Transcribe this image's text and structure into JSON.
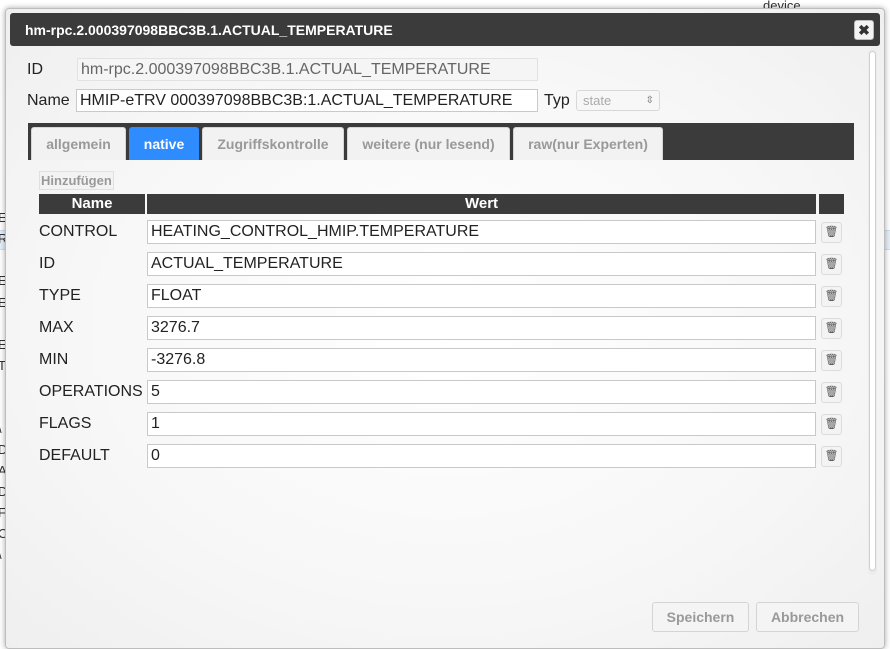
{
  "background": {
    "device_label": "device",
    "letters": [
      "E",
      "R",
      "EF",
      "E",
      "E",
      "T",
      "\\",
      "D",
      "A",
      "D",
      "F",
      "C",
      "\\"
    ]
  },
  "dialog": {
    "title": "hm-rpc.2.000397098BBC3B.1.ACTUAL_TEMPERATURE",
    "close_icon": "close-icon"
  },
  "fields": {
    "id_label": "ID",
    "id_value": "hm-rpc.2.000397098BBC3B.1.ACTUAL_TEMPERATURE",
    "name_label": "Name",
    "name_value": "HMIP-eTRV 000397098BBC3B:1.ACTUAL_TEMPERATURE",
    "typ_label": "Typ",
    "typ_value": "state"
  },
  "tabs": [
    {
      "label": "allgemein",
      "active": false
    },
    {
      "label": "native",
      "active": true
    },
    {
      "label": "Zugriffskontrolle",
      "active": false
    },
    {
      "label": "weitere (nur lesend)",
      "active": false
    },
    {
      "label": "raw(nur Experten)",
      "active": false
    }
  ],
  "native": {
    "add_label": "Hinzufügen",
    "col_name": "Name",
    "col_value": "Wert",
    "rows": [
      {
        "name": "CONTROL",
        "value": "HEATING_CONTROL_HMIP.TEMPERATURE"
      },
      {
        "name": "ID",
        "value": "ACTUAL_TEMPERATURE"
      },
      {
        "name": "TYPE",
        "value": "FLOAT"
      },
      {
        "name": "MAX",
        "value": "3276.7"
      },
      {
        "name": "MIN",
        "value": "-3276.8"
      },
      {
        "name": "OPERATIONS",
        "value": "5"
      },
      {
        "name": "FLAGS",
        "value": "1"
      },
      {
        "name": "DEFAULT",
        "value": "0"
      }
    ],
    "delete_icon": "trash-icon"
  },
  "footer": {
    "save_label": "Speichern",
    "cancel_label": "Abbrechen"
  },
  "colors": {
    "titlebar": "#3b3b3b",
    "active_tab": "#2f8cff"
  }
}
